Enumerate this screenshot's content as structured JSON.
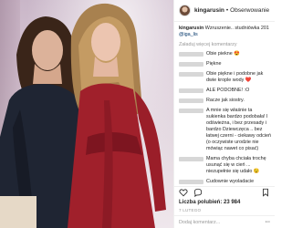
{
  "post": {
    "username": "kingarusin",
    "follow_label": "Obserwowanie",
    "caption_user": "kingarusin",
    "caption_text": "Wzruszenie.. studniówka 201",
    "caption_tag": "@iga_lis",
    "load_more": "Załaduj więcej komentarzy",
    "likes": "Liczba polubień: 23 984",
    "date": "7 LUTEGO",
    "add_comment_placeholder": "Dodaj komentarz...",
    "options_icon": "more-dots-icon"
  },
  "comments": [
    {
      "text": "Obie piekne 😍"
    },
    {
      "text": "Piękne"
    },
    {
      "text": "Obie piękne i podobne jak dwie krople wody ❤️"
    },
    {
      "text": "ALE PODOBNE! :O"
    },
    {
      "text": "Racze jak siostry."
    },
    {
      "text": "A mnie się właśnie ta sukienka bardzo podobała! I odświeżna, i bez przesady i bardzo Dziewczęca .. bez łatwej czerni - ciekawy odcień (o oczywiste urodzie nie mówiąc nawet co pisać)"
    },
    {
      "text": "Mama chyba chciała trochę usunąć się w cień ... niezupełnie się udało 😉"
    },
    {
      "text": "Cudownie wyoladacie"
    }
  ],
  "icons": {
    "like": "heart-icon",
    "comment": "comment-icon",
    "save": "bookmark-icon"
  }
}
